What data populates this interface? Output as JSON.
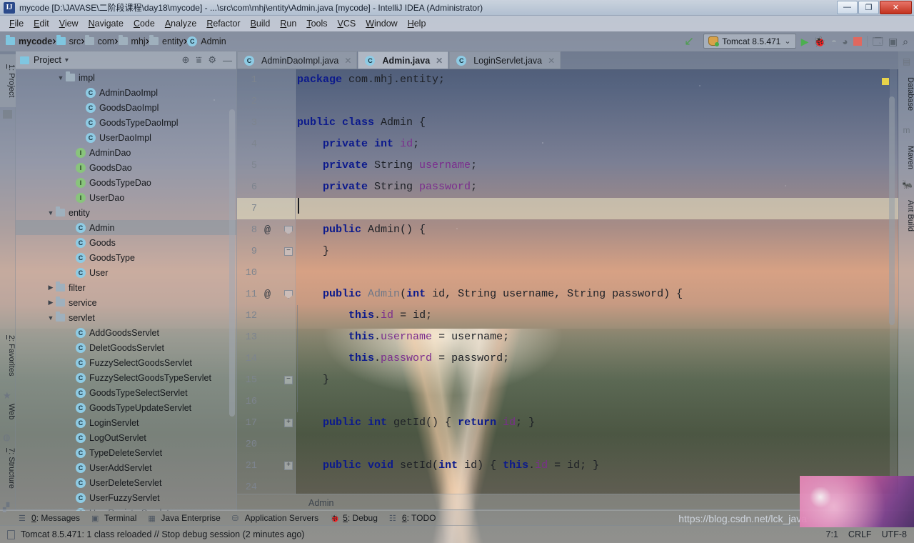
{
  "window": {
    "title": "mycode [D:\\JAVASE\\二阶段课程\\day18\\mycode] - ...\\src\\com\\mhj\\entity\\Admin.java [mycode] - IntelliJ IDEA (Administrator)",
    "app_icon_letter": "IJ",
    "minimize_glyph": "—",
    "maximize_glyph": "❐",
    "close_glyph": "✕"
  },
  "menu": {
    "items": [
      "File",
      "Edit",
      "View",
      "Navigate",
      "Code",
      "Analyze",
      "Refactor",
      "Build",
      "Run",
      "Tools",
      "VCS",
      "Window",
      "Help"
    ]
  },
  "navbar": {
    "crumbs": [
      {
        "label": "mycode",
        "icon": "folder-module-icon",
        "bold": true
      },
      {
        "label": "src",
        "icon": "folder-source-icon",
        "bold": false
      },
      {
        "label": "com",
        "icon": "folder-icon",
        "bold": false
      },
      {
        "label": "mhj",
        "icon": "folder-icon",
        "bold": false
      },
      {
        "label": "entity",
        "icon": "folder-icon",
        "bold": false
      },
      {
        "label": "Admin",
        "icon": "class-icon",
        "bold": false
      }
    ],
    "separator": "›"
  },
  "toolbar": {
    "back_arrow": "back-arrow-icon",
    "run_config_label": "Tomcat 8.5.471",
    "run_config_chevron": "⌄",
    "run_label": "Run",
    "debug_label": "Debug",
    "run_coverage_label": "Run with Coverage",
    "rerun_label": "Rerun",
    "stop_label": "Stop",
    "build_label": "Build Project",
    "update_label": "Update Application",
    "search_label": "Search Everywhere"
  },
  "left_strip": {
    "buttons": [
      {
        "label": "1: Project",
        "icon": "project-icon",
        "active": true
      },
      {
        "label": "2: Favorites",
        "icon": "star-icon",
        "active": false
      },
      {
        "label": "Web",
        "icon": "web-icon",
        "active": false
      },
      {
        "label": "7: Structure",
        "icon": "structure-icon",
        "active": false
      }
    ]
  },
  "right_strip": {
    "buttons": [
      {
        "label": "Database",
        "icon": "database-icon"
      },
      {
        "label": "Maven",
        "icon": "maven-icon"
      },
      {
        "label": "Ant Build",
        "icon": "ant-icon"
      }
    ]
  },
  "project_panel": {
    "title": "Project",
    "title_chevron": "▾",
    "locate_icon": "locate-icon",
    "collapse_icon": "collapse-all-icon",
    "settings_icon": "gear-icon",
    "hide_icon": "minimize-icon",
    "tree": [
      {
        "label": "impl",
        "type": "folder",
        "indent": 4,
        "twisty": "expanded"
      },
      {
        "label": "AdminDaoImpl",
        "type": "class",
        "indent": 6,
        "twisty": ""
      },
      {
        "label": "GoodsDaoImpl",
        "type": "class",
        "indent": 6,
        "twisty": ""
      },
      {
        "label": "GoodsTypeDaoImpl",
        "type": "class",
        "indent": 6,
        "twisty": ""
      },
      {
        "label": "UserDaoImpl",
        "type": "class",
        "indent": 6,
        "twisty": ""
      },
      {
        "label": "AdminDao",
        "type": "interface",
        "indent": 5,
        "twisty": ""
      },
      {
        "label": "GoodsDao",
        "type": "interface",
        "indent": 5,
        "twisty": ""
      },
      {
        "label": "GoodsTypeDao",
        "type": "interface",
        "indent": 5,
        "twisty": ""
      },
      {
        "label": "UserDao",
        "type": "interface",
        "indent": 5,
        "twisty": ""
      },
      {
        "label": "entity",
        "type": "folder",
        "indent": 3,
        "twisty": "expanded"
      },
      {
        "label": "Admin",
        "type": "class",
        "indent": 5,
        "twisty": "",
        "selected": true
      },
      {
        "label": "Goods",
        "type": "class",
        "indent": 5,
        "twisty": ""
      },
      {
        "label": "GoodsType",
        "type": "class",
        "indent": 5,
        "twisty": ""
      },
      {
        "label": "User",
        "type": "class",
        "indent": 5,
        "twisty": ""
      },
      {
        "label": "filter",
        "type": "folder",
        "indent": 3,
        "twisty": "collapsed"
      },
      {
        "label": "service",
        "type": "folder",
        "indent": 3,
        "twisty": "collapsed"
      },
      {
        "label": "servlet",
        "type": "folder",
        "indent": 3,
        "twisty": "expanded"
      },
      {
        "label": "AddGoodsServlet",
        "type": "class",
        "indent": 5,
        "twisty": ""
      },
      {
        "label": "DeletGoodsServlet",
        "type": "class",
        "indent": 5,
        "twisty": ""
      },
      {
        "label": "FuzzySelectGoodsServlet",
        "type": "class",
        "indent": 5,
        "twisty": ""
      },
      {
        "label": "FuzzySelectGoodsTypeServlet",
        "type": "class",
        "indent": 5,
        "twisty": ""
      },
      {
        "label": "GoodsTypeSelectServlet",
        "type": "class",
        "indent": 5,
        "twisty": ""
      },
      {
        "label": "GoodsTypeUpdateServlet",
        "type": "class",
        "indent": 5,
        "twisty": ""
      },
      {
        "label": "LoginServlet",
        "type": "class",
        "indent": 5,
        "twisty": ""
      },
      {
        "label": "LogOutServlet",
        "type": "class",
        "indent": 5,
        "twisty": ""
      },
      {
        "label": "TypeDeleteServlet",
        "type": "class",
        "indent": 5,
        "twisty": ""
      },
      {
        "label": "UserAddServlet",
        "type": "class",
        "indent": 5,
        "twisty": ""
      },
      {
        "label": "UserDeleteServlet",
        "type": "class",
        "indent": 5,
        "twisty": ""
      },
      {
        "label": "UserFuzzyServlet",
        "type": "class",
        "indent": 5,
        "twisty": ""
      },
      {
        "label": "UserRegisterServlet",
        "type": "class",
        "indent": 5,
        "twisty": ""
      }
    ]
  },
  "editor": {
    "tabs": [
      {
        "label": "AdminDaoImpl.java",
        "icon": "class-icon",
        "active": false,
        "close": "✕"
      },
      {
        "label": "Admin.java",
        "icon": "class-icon",
        "active": true,
        "close": "✕"
      },
      {
        "label": "LoginServlet.java",
        "icon": "class-icon",
        "active": false,
        "close": "✕"
      }
    ],
    "breadcrumb": "Admin",
    "lines": [
      {
        "num": "1",
        "marker": "",
        "fold": "",
        "tokens": [
          {
            "t": "package",
            "c": "kw"
          },
          {
            "t": " com.mhj.entity;",
            "c": "pl"
          }
        ]
      },
      {
        "num": "2",
        "marker": "",
        "fold": "",
        "tokens": []
      },
      {
        "num": "3",
        "marker": "",
        "fold": "",
        "tokens": [
          {
            "t": "public class",
            "c": "kw"
          },
          {
            "t": " Admin {",
            "c": "pl"
          }
        ]
      },
      {
        "num": "4",
        "marker": "",
        "fold": "",
        "tokens": [
          {
            "t": "    ",
            "c": "pl"
          },
          {
            "t": "private int",
            "c": "kw"
          },
          {
            "t": " ",
            "c": "pl"
          },
          {
            "t": "id",
            "c": "fld"
          },
          {
            "t": ";",
            "c": "pl"
          }
        ]
      },
      {
        "num": "5",
        "marker": "",
        "fold": "",
        "tokens": [
          {
            "t": "    ",
            "c": "pl"
          },
          {
            "t": "private",
            "c": "kw"
          },
          {
            "t": " String ",
            "c": "pl"
          },
          {
            "t": "username",
            "c": "fld"
          },
          {
            "t": ";",
            "c": "pl"
          }
        ]
      },
      {
        "num": "6",
        "marker": "",
        "fold": "",
        "tokens": [
          {
            "t": "    ",
            "c": "pl"
          },
          {
            "t": "private",
            "c": "kw"
          },
          {
            "t": " String ",
            "c": "pl"
          },
          {
            "t": "password",
            "c": "fld"
          },
          {
            "t": ";",
            "c": "pl"
          }
        ]
      },
      {
        "num": "7",
        "marker": "",
        "fold": "",
        "caret": true,
        "tokens": []
      },
      {
        "num": "8",
        "marker": "@",
        "fold": "top",
        "tokens": [
          {
            "t": "    ",
            "c": "pl"
          },
          {
            "t": "public",
            "c": "kw"
          },
          {
            "t": " Admin() {",
            "c": "pl"
          }
        ]
      },
      {
        "num": "9",
        "marker": "",
        "fold": "bottom",
        "tokens": [
          {
            "t": "    }",
            "c": "pl"
          }
        ]
      },
      {
        "num": "10",
        "marker": "",
        "fold": "",
        "tokens": []
      },
      {
        "num": "11",
        "marker": "@",
        "fold": "top",
        "tokens": [
          {
            "t": "    ",
            "c": "pl"
          },
          {
            "t": "public",
            "c": "kw"
          },
          {
            "t": " ",
            "c": "pl"
          },
          {
            "t": "Admin",
            "c": "cls"
          },
          {
            "t": "(",
            "c": "pl"
          },
          {
            "t": "int",
            "c": "kw"
          },
          {
            "t": " id, String username, String password) {",
            "c": "pl"
          }
        ]
      },
      {
        "num": "12",
        "marker": "",
        "fold": "",
        "tokens": [
          {
            "t": "        ",
            "c": "pl"
          },
          {
            "t": "this",
            "c": "kw"
          },
          {
            "t": ".",
            "c": "pl"
          },
          {
            "t": "id",
            "c": "fld"
          },
          {
            "t": " = id;",
            "c": "pl"
          }
        ]
      },
      {
        "num": "13",
        "marker": "",
        "fold": "",
        "tokens": [
          {
            "t": "        ",
            "c": "pl"
          },
          {
            "t": "this",
            "c": "kw"
          },
          {
            "t": ".",
            "c": "pl"
          },
          {
            "t": "username",
            "c": "fld"
          },
          {
            "t": " = username;",
            "c": "pl"
          }
        ]
      },
      {
        "num": "14",
        "marker": "",
        "fold": "",
        "tokens": [
          {
            "t": "        ",
            "c": "pl"
          },
          {
            "t": "this",
            "c": "kw"
          },
          {
            "t": ".",
            "c": "pl"
          },
          {
            "t": "password",
            "c": "fld"
          },
          {
            "t": " = password;",
            "c": "pl"
          }
        ]
      },
      {
        "num": "15",
        "marker": "",
        "fold": "bottom",
        "tokens": [
          {
            "t": "    }",
            "c": "pl"
          }
        ]
      },
      {
        "num": "16",
        "marker": "",
        "fold": "",
        "tokens": []
      },
      {
        "num": "17",
        "marker": "",
        "fold": "plus",
        "tokens": [
          {
            "t": "    ",
            "c": "pl"
          },
          {
            "t": "public int",
            "c": "kw"
          },
          {
            "t": " getId() { ",
            "c": "pl"
          },
          {
            "t": "return",
            "c": "kw"
          },
          {
            "t": " ",
            "c": "pl"
          },
          {
            "t": "id",
            "c": "fld"
          },
          {
            "t": "; }",
            "c": "pl"
          }
        ]
      },
      {
        "num": "20",
        "marker": "",
        "fold": "",
        "tokens": []
      },
      {
        "num": "21",
        "marker": "",
        "fold": "plus",
        "tokens": [
          {
            "t": "    ",
            "c": "pl"
          },
          {
            "t": "public void",
            "c": "kw"
          },
          {
            "t": " setId(",
            "c": "pl"
          },
          {
            "t": "int",
            "c": "kw"
          },
          {
            "t": " id) { ",
            "c": "pl"
          },
          {
            "t": "this",
            "c": "kw"
          },
          {
            "t": ".",
            "c": "pl"
          },
          {
            "t": "id",
            "c": "fld"
          },
          {
            "t": " = id; }",
            "c": "pl"
          }
        ]
      },
      {
        "num": "24",
        "marker": "",
        "fold": "",
        "tokens": []
      }
    ]
  },
  "bottom_strip": {
    "buttons": [
      {
        "label": "0: Messages",
        "icon": "messages-icon"
      },
      {
        "label": "Terminal",
        "icon": "terminal-icon"
      },
      {
        "label": "Java Enterprise",
        "icon": "java-enterprise-icon"
      },
      {
        "label": "Application Servers",
        "icon": "application-servers-icon"
      },
      {
        "label": "5: Debug",
        "icon": "debug-icon"
      },
      {
        "label": "6: TODO",
        "icon": "todo-icon"
      }
    ]
  },
  "status_bar": {
    "message": "Tomcat 8.5.471: 1 class reloaded // Stop debug session (2 minutes ago)",
    "caret_position": "7:1",
    "line_separator": "CRLF",
    "encoding": "UTF-8",
    "doc_icon": "document-icon"
  },
  "watermark": {
    "url": "https://blog.csdn.net/lck_java"
  },
  "colors": {
    "keyword": "#0c1a8c",
    "field": "#7b2d8e",
    "class_icon_bg": "#8ecbe4",
    "interface_icon_bg": "#89c47c",
    "caret_line": "#ece8c4",
    "selection": "#919299"
  }
}
